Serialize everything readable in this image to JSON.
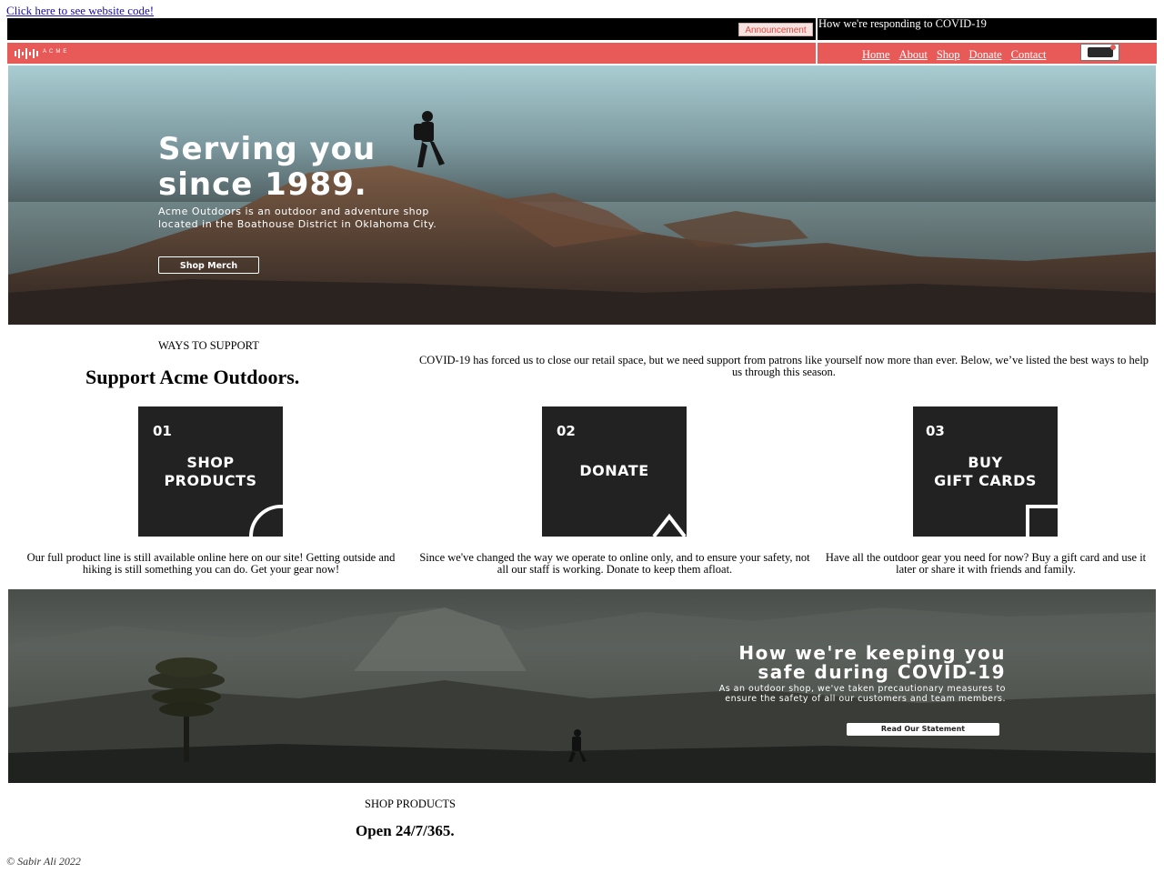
{
  "top_link": "Click here to see website code!",
  "announcement": {
    "button_label": "Announcement",
    "covid_text": "How we're responding to COVID-19"
  },
  "header": {
    "logo_text": "ACME",
    "nav": [
      "Home",
      "About",
      "Shop",
      "Donate",
      "Contact"
    ],
    "cart_icon": "cart-icon"
  },
  "hero": {
    "title_line1": "Serving you",
    "title_line2": "since 1989.",
    "text": "Acme Outdoors is an outdoor and adventure shop located in the Boathouse District in Oklahoma City.",
    "button": "Shop Merch"
  },
  "support": {
    "label": "WAYS TO SUPPORT",
    "title": "Support Acme Outdoors.",
    "description": "COVID-19 has forced us to close our retail space, but we need support from patrons like yourself now more than ever. Below, we’ve listed the best ways to help us through this season.",
    "cards": [
      {
        "number": "01",
        "title_line1": "SHOP",
        "title_line2": "PRODUCTS",
        "description": "Our full product line is still available online here on our site! Getting outside and hiking is still something you can do. Get your gear now!"
      },
      {
        "number": "02",
        "title_line1": "DONATE",
        "title_line2": "",
        "description": "Since we've changed the way we operate to online only, and to ensure your safety, not all our staff is working. Donate to keep them afloat."
      },
      {
        "number": "03",
        "title_line1": "BUY",
        "title_line2": "GIFT CARDS",
        "description": "Have all the outdoor gear you need for now? Buy a gift card and use it later or share it with friends and family."
      }
    ]
  },
  "covid": {
    "title_line1": "How we're keeping you",
    "title_line2": "safe during COVID-19",
    "description": "As an outdoor shop, we've taken precautionary measures to ensure the safety of all our customers and team members.",
    "button": "Read Our Statement"
  },
  "shop": {
    "label": "SHOP PRODUCTS",
    "title": "Open 24/7/365."
  },
  "footer": "© Sabir Ali 2022",
  "colors": {
    "brand_red": "#e85a58",
    "card_dark": "#222222",
    "black": "#000000"
  }
}
